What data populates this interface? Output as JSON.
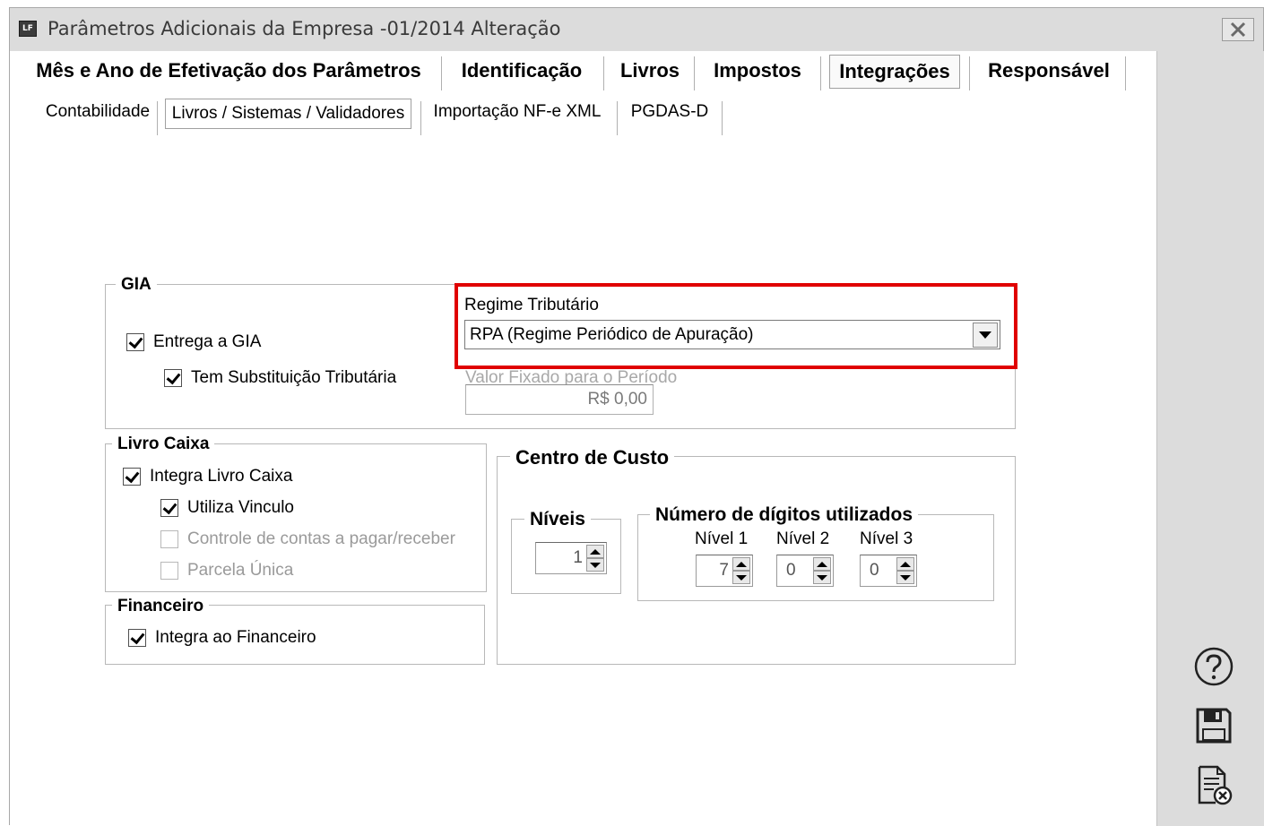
{
  "window": {
    "app_icon_text": "LF",
    "title": "Parâmetros Adicionais da Empresa -01/2014 Alteração"
  },
  "main_tabs": [
    {
      "label": "Mês e Ano de Efetivação dos Parâmetros",
      "active": false
    },
    {
      "label": "Identificação",
      "active": false
    },
    {
      "label": "Livros",
      "active": false
    },
    {
      "label": "Impostos",
      "active": false
    },
    {
      "label": "Integrações",
      "active": true
    },
    {
      "label": "Responsável",
      "active": false
    }
  ],
  "sub_tabs": [
    {
      "label": "Contabilidade",
      "active": false
    },
    {
      "label": "Livros / Sistemas / Validadores",
      "active": true
    },
    {
      "label": "Importação NF-e XML",
      "active": false
    },
    {
      "label": "PGDAS-D",
      "active": false
    }
  ],
  "gia": {
    "title": "GIA",
    "entrega_label": "Entrega a GIA",
    "entrega_checked": true,
    "substituicao_label": "Tem Substituição Tributária",
    "substituicao_checked": true,
    "regime_label": "Regime Tributário",
    "regime_value": "RPA (Regime Periódico de Apuração)",
    "valor_label": "Valor Fixado para o Período",
    "valor_value": "R$ 0,00"
  },
  "livro_caixa": {
    "title": "Livro Caixa",
    "integra_label": "Integra Livro Caixa",
    "integra_checked": true,
    "vinculo_label": "Utiliza Vinculo",
    "vinculo_checked": true,
    "controle_label": "Controle de contas a pagar/receber",
    "controle_checked": false,
    "parcela_label": "Parcela Única",
    "parcela_checked": false
  },
  "financeiro": {
    "title": "Financeiro",
    "integra_label": "Integra ao Financeiro",
    "integra_checked": true
  },
  "centro_custo": {
    "title": "Centro de Custo",
    "niveis_title": "Níveis",
    "niveis_value": "1",
    "digitos_title": "Número de dígitos utilizados",
    "nivel1_label": "Nível 1",
    "nivel1_value": "7",
    "nivel2_label": "Nível 2",
    "nivel2_value": "0",
    "nivel3_label": "Nível 3",
    "nivel3_value": "0"
  },
  "side_icons": [
    "help-icon",
    "save-icon",
    "cancel-document-icon"
  ],
  "colors": {
    "highlight": "#e00000",
    "chrome": "#dcdcdc"
  }
}
